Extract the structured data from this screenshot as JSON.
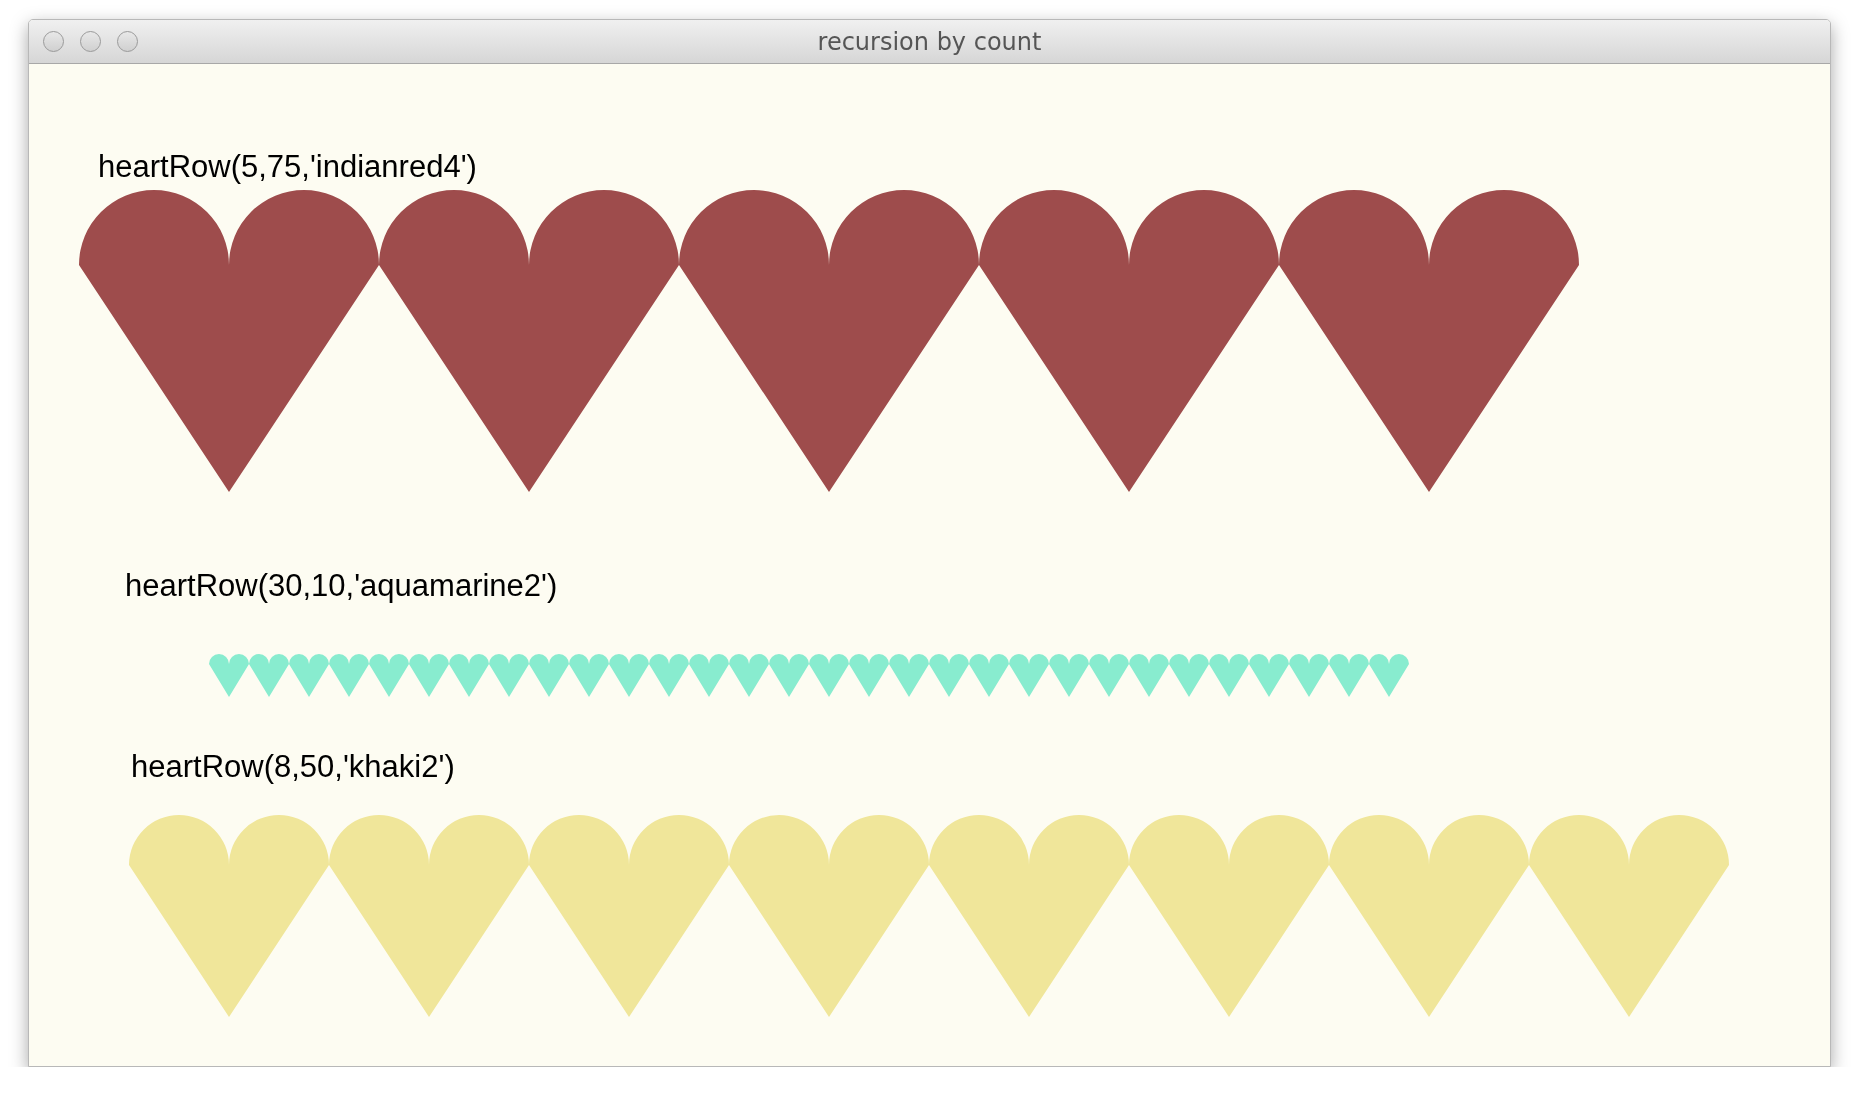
{
  "window": {
    "title": "recursion by count"
  },
  "rows": [
    {
      "label": "heartRow(5,75,'indianred4')",
      "color": "#9e4c4c"
    },
    {
      "label": "heartRow(30,10,'aquamarine2')",
      "color": "#88eccf"
    },
    {
      "label": "heartRow(8,50,'khaki2')",
      "color": "#f0e69a"
    }
  ]
}
